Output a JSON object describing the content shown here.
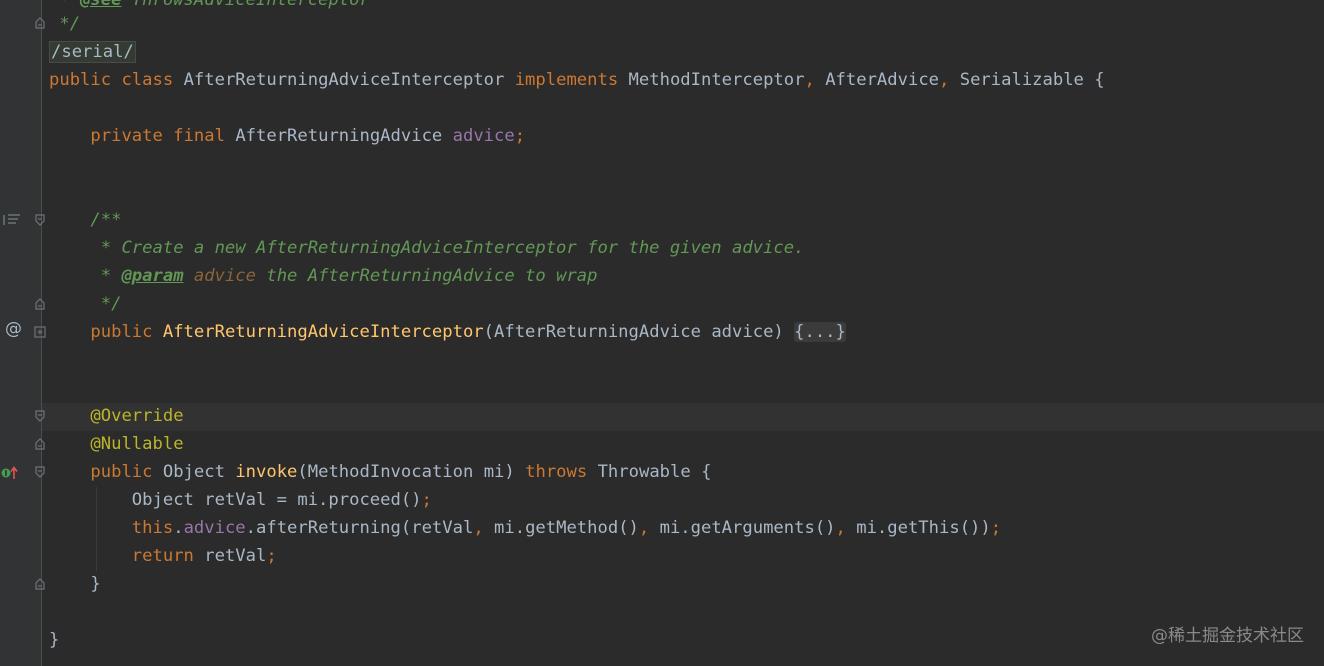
{
  "editor": {
    "lines": {
      "l1": {
        "t1": " * ",
        "t2": "@see",
        "t3": " ThrowsAdviceInterceptor"
      },
      "l2": " */",
      "l3": "/serial/",
      "l4": {
        "kw1": "public",
        "kw2": "class",
        "name": "AfterReturningAdviceInterceptor",
        "kw3": "implements",
        "i1": "MethodInterceptor",
        "sep1": ",",
        "i2": "AfterAdvice",
        "sep2": ",",
        "i3": "Serializable",
        "brace": "{"
      },
      "l5": {
        "kw1": "private",
        "kw2": "final",
        "type": "AfterReturningAdvice",
        "field": "advice",
        "semi": ";"
      },
      "l6": "/**",
      "l7": " * Create a new AfterReturningAdviceInterceptor for the given advice.",
      "l8": {
        "star": " * ",
        "tag": "@param",
        "pname": "advice",
        "rest": " the AfterReturningAdvice to wrap"
      },
      "l9": " */",
      "l10": {
        "kw": "public",
        "ctor": "AfterReturningAdviceInterceptor",
        "open": "(",
        "ptype": "AfterReturningAdvice",
        "pname": "advice",
        "close": ")",
        "folded": "{...}"
      },
      "l11": "@Override",
      "l12": "@Nullable",
      "l13": {
        "kw": "public",
        "rtype": "Object",
        "method": "invoke",
        "open": "(",
        "ptype": "MethodInvocation",
        "pname": "mi",
        "close": ")",
        "kw2": "throws",
        "ex": "Throwable",
        "brace": "{"
      },
      "l14": {
        "code": "Object retVal = mi.proceed()",
        "semi": ";"
      },
      "l15": {
        "kw": "this",
        "dot": ".",
        "field": "advice",
        "c1": ".afterReturning(retVal",
        "s1": ",",
        "c2": " mi.getMethod()",
        "s2": ",",
        "c3": " mi.getArguments()",
        "s3": ",",
        "c4": " mi.getThis())",
        "semi": ";"
      },
      "l16": {
        "kw": "return",
        "code": " retVal",
        "semi": ";"
      },
      "l17": "}",
      "l18": "}"
    }
  },
  "gutter": {
    "at_symbol": "@"
  },
  "watermark": "@稀土掘金技术社区",
  "colors": {
    "background": "#2b2b2b",
    "keyword": "#cc7832",
    "field": "#9876aa",
    "method": "#ffc66d",
    "annotation": "#bbb529",
    "comment": "#629755",
    "text": "#a9b7c6"
  },
  "icons": {
    "fold": "fold-collapse-icon",
    "expand": "fold-expand-icon",
    "doc_toggle": "rendered-doc-icon",
    "override": "override-method-icon"
  }
}
